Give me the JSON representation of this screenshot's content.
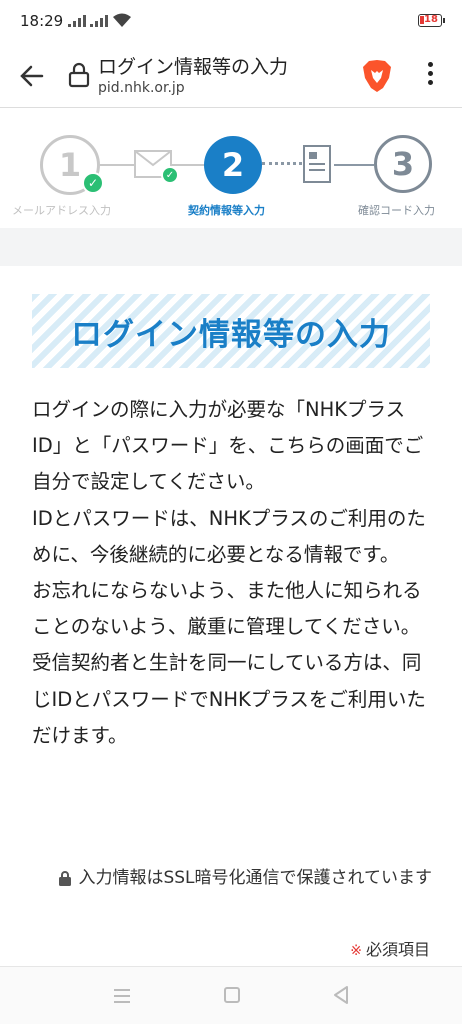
{
  "status_bar": {
    "time": "18:29",
    "battery_level": "18",
    "battery_color": "#e53935"
  },
  "browser": {
    "title": "ログイン情報等の入力",
    "url": "pid.nhk.or.jp",
    "icons": [
      "back-arrow-icon",
      "lock-icon",
      "brave-lion-icon",
      "more-vert-icon"
    ]
  },
  "stepper": {
    "steps": [
      {
        "number": "1",
        "label": "メールアドレス入力",
        "state": "done"
      },
      {
        "number": "",
        "label": "",
        "state": "done-envelope"
      },
      {
        "number": "2",
        "label": "契約情報等入力",
        "state": "current"
      },
      {
        "number": "",
        "label": "",
        "state": "todo-document"
      },
      {
        "number": "3",
        "label": "確認コード入力",
        "state": "todo"
      }
    ],
    "accent_color": "#1a7fc7",
    "check_color": "#2bbf74"
  },
  "main": {
    "heading": "ログイン情報等の入力",
    "paragraphs": [
      "ログインの際に入力が必要な「NHKプラスID」と「パスワード」を、こちらの画面でご自分で設定してください。",
      "IDとパスワードは、NHKプラスのご利用のために、今後継続的に必要となる情報です。",
      "お忘れにならないよう、また他人に知られることのないよう、厳重に管理してください。",
      "受信契約者と生計を同一にしている方は、同じIDとパスワードでNHKプラスをご利用いただけます。"
    ],
    "ssl_note": "入力情報はSSL暗号化通信で保護されています",
    "required_mark": "※",
    "required_label": "必須項目"
  },
  "nav_bar": {
    "icons": [
      "menu-icon",
      "home-square-icon",
      "back-triangle-icon"
    ]
  }
}
